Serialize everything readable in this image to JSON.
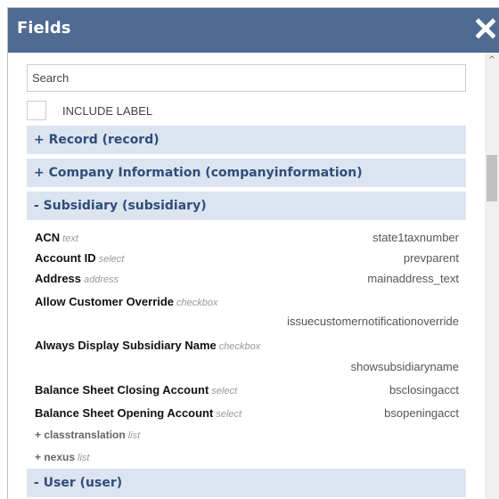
{
  "dialog": {
    "title": "Fields",
    "close_icon": "close-icon"
  },
  "search": {
    "placeholder": "Search",
    "value": ""
  },
  "include_label": {
    "label": "INCLUDE LABEL",
    "checked": false
  },
  "sections": [
    {
      "label": "+ Record (record)"
    },
    {
      "label": "+ Company Information (companyinformation)"
    },
    {
      "label": "- Subsidiary (subsidiary)"
    },
    {
      "label": "- User (user)"
    }
  ],
  "fields": [
    {
      "name": "ACN",
      "type": "text",
      "id": "state1taxnumber"
    },
    {
      "name": "Account ID",
      "type": "select",
      "id": "prevparent"
    },
    {
      "name": "Address",
      "type": "address",
      "id": "mainaddress_text"
    },
    {
      "name": "Allow Customer Override",
      "type": "checkbox",
      "id": "issuecustomernotificationoverride"
    },
    {
      "name": "Always Display Subsidiary Name",
      "type": "checkbox",
      "id": "showsubsidiaryname"
    },
    {
      "name": "Balance Sheet Closing Account",
      "type": "select",
      "id": "bsclosingacct"
    },
    {
      "name": "Balance Sheet Opening Account",
      "type": "select",
      "id": "bsopeningacct"
    }
  ],
  "subgroups": [
    {
      "name": "+ classtranslation",
      "type": "list"
    },
    {
      "name": "+ nexus",
      "type": "list"
    }
  ]
}
